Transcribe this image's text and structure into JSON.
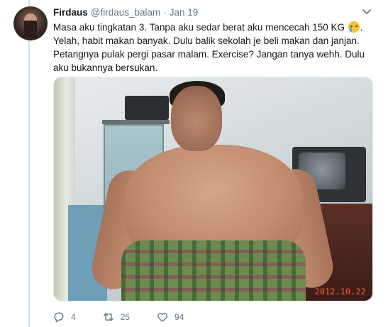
{
  "tweet": {
    "display_name": "Firdaus",
    "handle": "@firdaus_balam",
    "separator": "·",
    "date": "Jan 19",
    "text_before_emoji": "Masa aku tingkatan 3. Tanpa aku sedar berat aku mencecah 150 KG ",
    "emoji": "crying-face-emoji",
    "text_after_emoji": ". Yelah, habit makan banyak. Dulu balik sekolah je beli makan dan janjan. Petangnya pulak pergi pasar malam. Exercise? Jangan tanya wehh. Dulu aku bukannya bersukan.",
    "photo": {
      "date_stamp": "2012.10.22"
    },
    "actions": {
      "reply_count": "4",
      "retweet_count": "25",
      "like_count": "94"
    }
  },
  "colors": {
    "text_primary": "#14171a",
    "text_secondary": "#657786",
    "thread_line": "#cfe3f4",
    "stamp": "#ff5d3a"
  },
  "icons": {
    "reply": "reply-icon",
    "retweet": "retweet-icon",
    "like": "heart-icon",
    "more": "chevron-down-icon"
  }
}
